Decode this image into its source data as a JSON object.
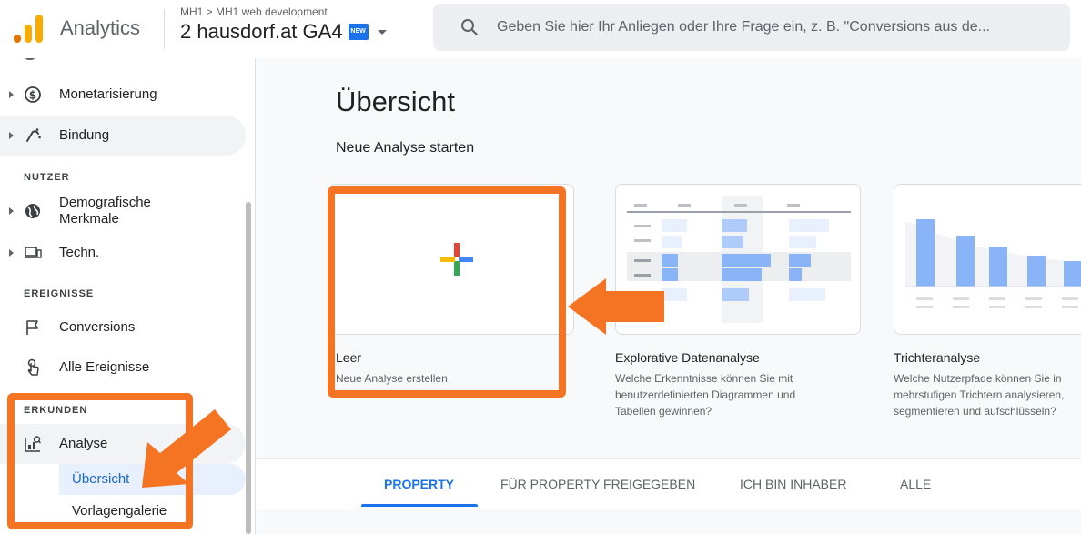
{
  "header": {
    "app_name": "Analytics",
    "breadcrumb": "MH1 > MH1 web development",
    "property": "2 hausdorf.at GA4",
    "new_badge": "NEW",
    "search_placeholder": "Geben Sie hier Ihr Anliegen oder Ihre Frage ein, z. B. \"Conversions aus de...",
    "icons": {
      "logo": "analytics-logo",
      "search": "search-icon",
      "property_dropdown": "chevron-down-icon"
    }
  },
  "sidebar": {
    "items": [
      {
        "label": "Monetarisierung",
        "icon": "dollar-icon"
      },
      {
        "label": "Bindung",
        "icon": "retention-icon"
      },
      {
        "label": "Demografische Merkmale",
        "icon": "globe-icon"
      },
      {
        "label": "Techn.",
        "icon": "devices-icon"
      },
      {
        "label": "Conversions",
        "icon": "flag-icon"
      },
      {
        "label": "Alle Ereignisse",
        "icon": "touch-icon"
      },
      {
        "label": "Analyse",
        "icon": "explore-icon"
      }
    ],
    "sections": {
      "nutzer": "NUTZER",
      "ereignisse": "EREIGNISSE",
      "erkunden": "ERKUNDEN"
    },
    "sub_items": [
      {
        "label": "Übersicht",
        "active": true
      },
      {
        "label": "Vorlagengalerie",
        "active": false
      }
    ]
  },
  "main": {
    "title": "Übersicht",
    "subtitle": "Neue Analyse starten",
    "cards": [
      {
        "title": "Leer",
        "desc": "Neue Analyse erstellen"
      },
      {
        "title": "Explorative Datenanalyse",
        "desc": "Welche Erkenntnisse können Sie mit benutzerdefinierten Diagrammen und Tabellen gewinnen?"
      },
      {
        "title": "Trichteranalyse",
        "desc": "Welche Nutzerpfade können Sie in mehrstufigen Trichtern analysieren, segmentieren und aufschlüsseln?"
      }
    ],
    "tabs": [
      {
        "label": "PROPERTY",
        "active": true
      },
      {
        "label": "FÜR PROPERTY FREIGEGEBEN",
        "active": false
      },
      {
        "label": "ICH BIN INHABER",
        "active": false
      },
      {
        "label": "ALLE",
        "active": false
      }
    ]
  },
  "colors": {
    "accent": "#1a73e8",
    "annotation": "#f57423",
    "chart_bar": "#8ab4f8"
  }
}
